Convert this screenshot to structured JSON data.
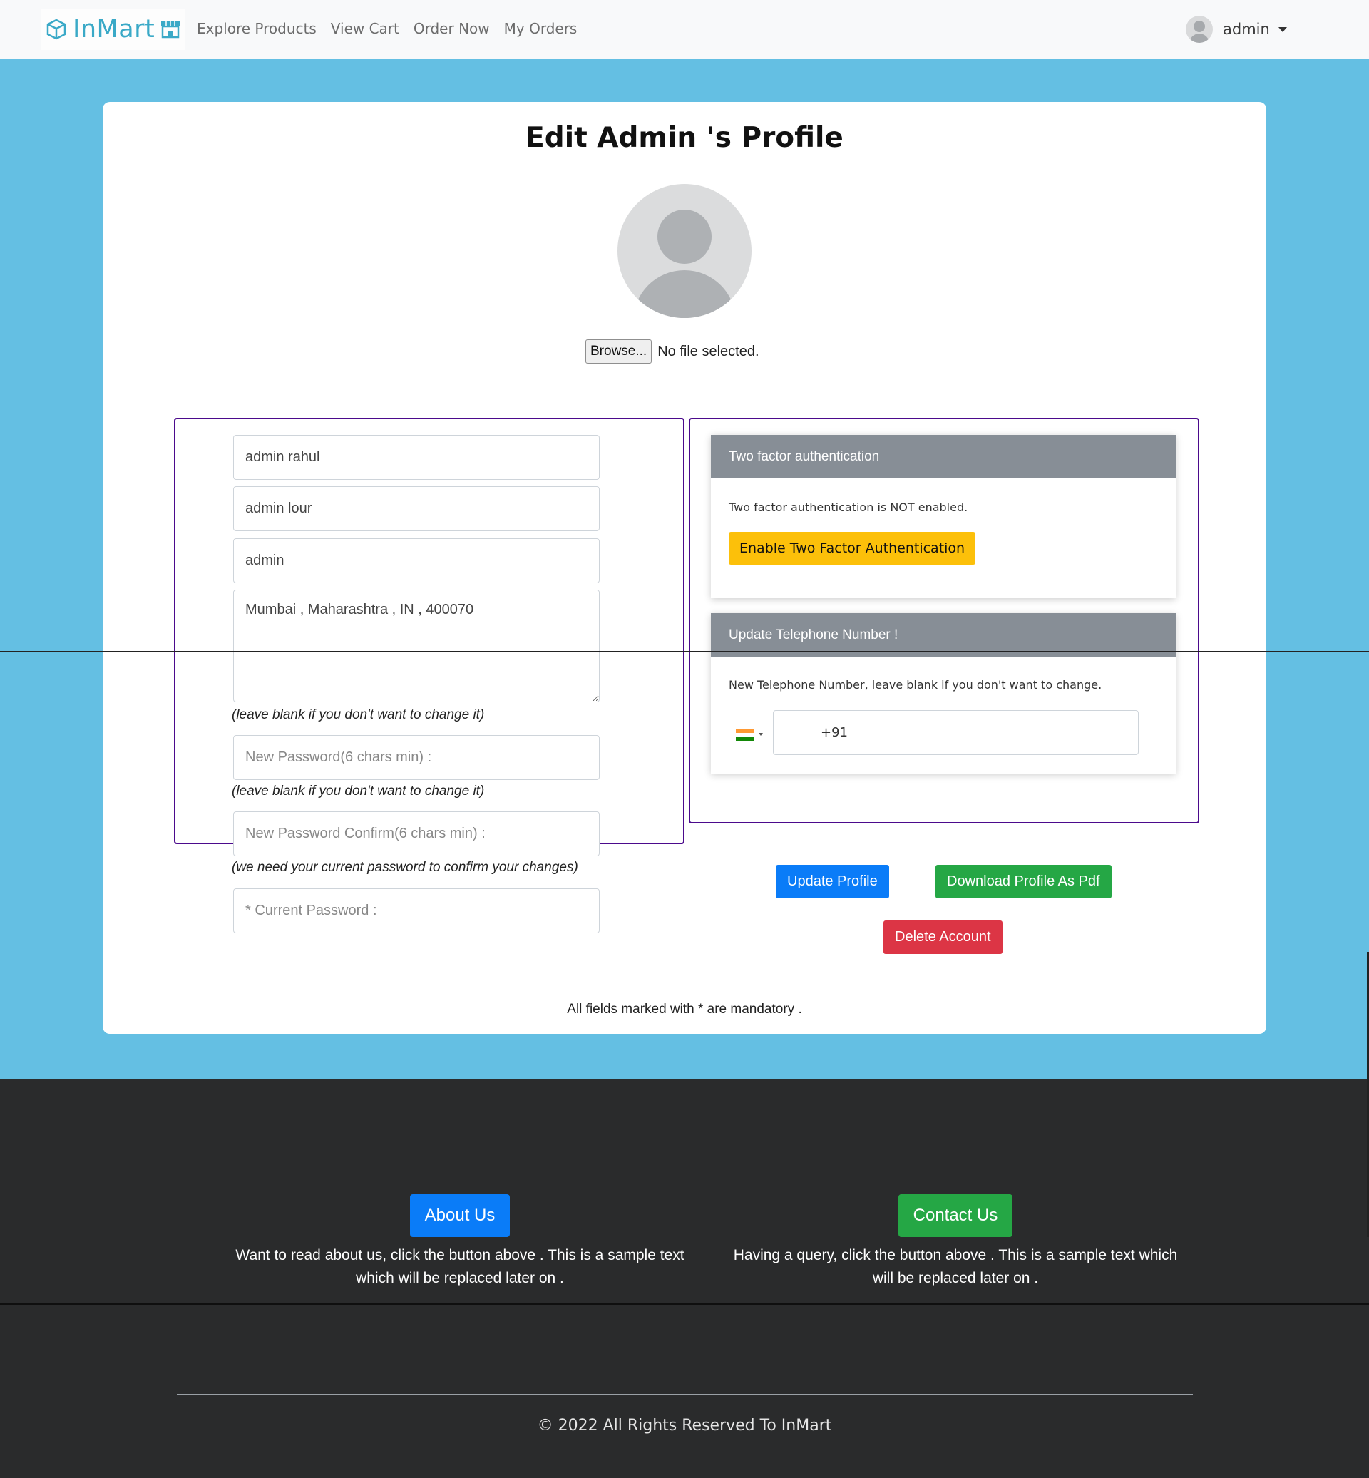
{
  "navbar": {
    "brand": "InMart",
    "links": [
      "Explore Products",
      "View Cart",
      "Order Now",
      "My Orders"
    ],
    "user_name": "admin"
  },
  "profile": {
    "title": "Edit Admin 's Profile",
    "browse_label": "Browse...",
    "file_status": "No file selected.",
    "first_name": "admin rahul",
    "last_name": "admin lour",
    "username": "admin",
    "address": "Mumbai , Maharashtra , IN , 400070",
    "hint_new_password": "(leave blank if you don't want to change it)",
    "new_password_placeholder": "New Password(6 chars min) :",
    "hint_confirm_password": "(leave blank if you don't want to change it)",
    "confirm_password_placeholder": "New Password Confirm(6 chars min) :",
    "hint_current_password": "(we need your current password to confirm your changes)",
    "current_password_placeholder": "* Current Password :",
    "footnote": "All fields marked with * are mandatory ."
  },
  "two_factor": {
    "header": "Two factor authentication",
    "status_text": "Two factor authentication is NOT enabled.",
    "button_label": "Enable Two Factor Authentication"
  },
  "telephone": {
    "header": "Update Telephone Number !",
    "hint": "New Telephone Number, leave blank if you don't want to change.",
    "country": "India",
    "value": "+91"
  },
  "actions": {
    "update_profile": "Update Profile",
    "download_pdf": "Download Profile As Pdf",
    "delete_account": "Delete Account"
  },
  "footer": {
    "about_button": "About Us",
    "about_text": "Want to read about us, click the button above . This is a sample text which will be replaced later on .",
    "contact_button": "Contact Us",
    "contact_text": "Having a query, click the button above . This is a sample text which will be replaced later on .",
    "copyright": "© 2022 All Rights Reserved To InMart"
  },
  "colors": {
    "primary": "#0a7cf8",
    "success": "#25a745",
    "danger": "#dc3545",
    "warning": "#fcc00a",
    "background": "#64bfe3",
    "panel_border": "#4b0a8c",
    "footer_bg": "#2a2b2c"
  }
}
